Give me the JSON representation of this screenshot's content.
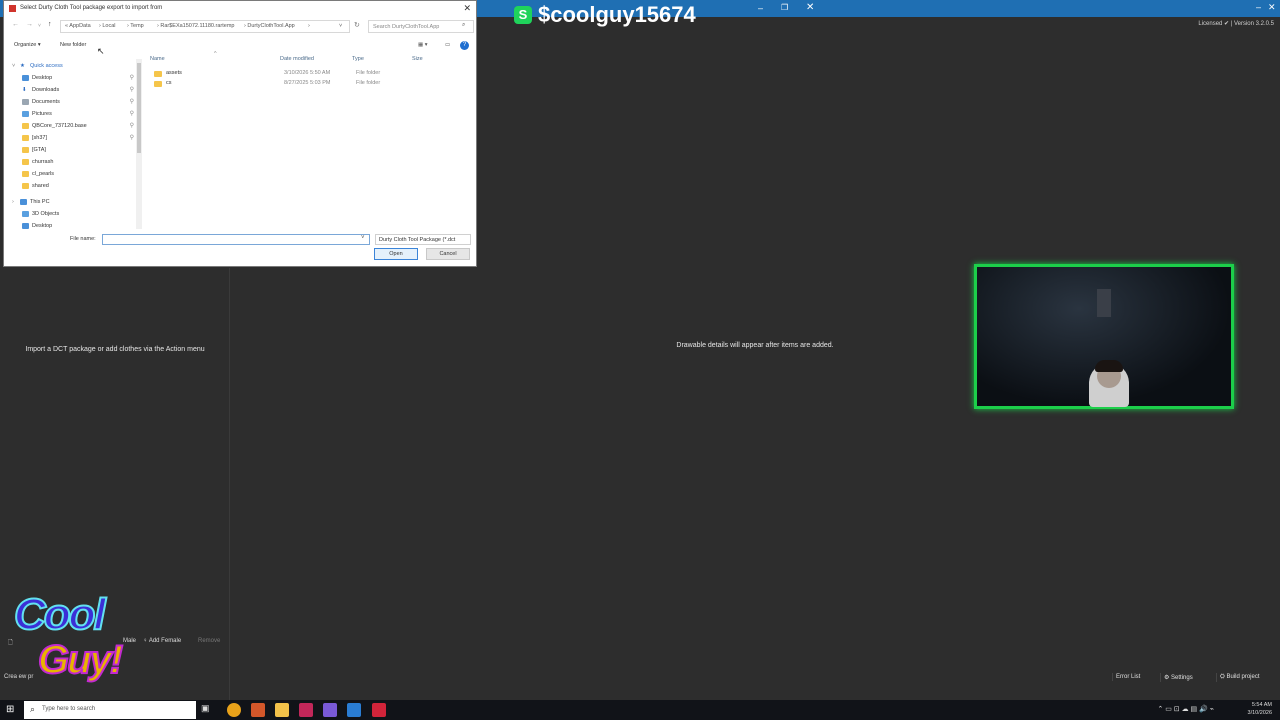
{
  "app": {
    "license_text": "Licensed ✔ | Version 3.2.0.5",
    "left_empty_message": "Import a DCT package or add clothes via the Action menu",
    "right_empty_message": "Drawable details will appear after items are added.",
    "actions": {
      "male": "Male",
      "add_female": "Add Female",
      "remove": "Remove"
    },
    "status": "Crea   ew pr",
    "bottom": {
      "error_list": "Error List",
      "settings": "Settings",
      "build_project": "Build project"
    }
  },
  "cash": {
    "badge": "S",
    "handle": "$coolguy15674"
  },
  "dialog": {
    "title": "Select Durty Cloth Tool package export to import from",
    "address": [
      "«  AppData",
      "›  Local",
      "›  Temp",
      "›  Rar$EXa15072.11180.rartemp",
      "›  DurtyClothTool.App",
      "›"
    ],
    "search_placeholder": "Search DurtyClothTool.App",
    "toolbar": {
      "organize": "Organize ▾",
      "new_folder": "New folder"
    },
    "nav_items": [
      {
        "label": "Quick access",
        "type": "star"
      },
      {
        "label": "Desktop",
        "type": "desktop",
        "pinned": true
      },
      {
        "label": "Downloads",
        "type": "download",
        "pinned": true
      },
      {
        "label": "Documents",
        "type": "doc",
        "pinned": true
      },
      {
        "label": "Pictures",
        "type": "folder",
        "pinned": true
      },
      {
        "label": "QBCore_737120.base",
        "type": "folder",
        "pinned": true
      },
      {
        "label": "[sh37]",
        "type": "folder",
        "pinned": true
      },
      {
        "label": "[GTA]",
        "type": "folder"
      },
      {
        "label": "churrash",
        "type": "folder"
      },
      {
        "label": "cl_pearls",
        "type": "folder"
      },
      {
        "label": "shared",
        "type": "folder"
      },
      {
        "label": "This PC",
        "type": "pc"
      },
      {
        "label": "3D Objects",
        "type": "folder"
      },
      {
        "label": "Desktop",
        "type": "desktop"
      }
    ],
    "columns": {
      "name": "Name",
      "date": "Date modified",
      "type": "Type",
      "size": "Size"
    },
    "files": [
      {
        "name": "assets",
        "date": "3/10/2026 5:50 AM",
        "type": "File folder"
      },
      {
        "name": "cs",
        "date": "8/27/2025 5:03 PM",
        "type": "File folder"
      }
    ],
    "file_name_label": "File name:",
    "file_name_value": "",
    "file_type": "Durty Cloth Tool Package (*.dct",
    "open_label": "Open",
    "cancel_label": "Cancel"
  },
  "logo": {
    "line1": "Cool",
    "line2": "Guy!"
  },
  "taskbar": {
    "search_placeholder": "Type here to search",
    "time": "5:54 AM",
    "date": "3/10/2026"
  },
  "colors": {
    "accent": "#1f6fb3",
    "webcam_border": "#1ccf4a",
    "cash_green": "#1fd35b"
  }
}
